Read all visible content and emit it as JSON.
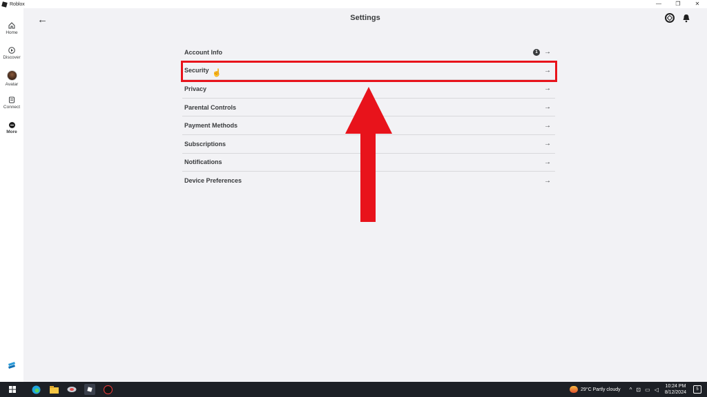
{
  "window": {
    "title": "Roblox",
    "controls": [
      "—",
      "❐",
      "✕"
    ]
  },
  "rail": {
    "items": [
      {
        "label": "Home",
        "icon": "home-icon"
      },
      {
        "label": "Discover",
        "icon": "play-icon"
      },
      {
        "label": "Avatar",
        "icon": "avatar-image"
      },
      {
        "label": "Connect",
        "icon": "chat-icon"
      },
      {
        "label": "More",
        "icon": "more-icon"
      }
    ]
  },
  "header": {
    "back_glyph": "←",
    "title": "Settings"
  },
  "settings": {
    "items": [
      {
        "label": "Account Info",
        "badge": "1",
        "arrow": "→"
      },
      {
        "label": "Security",
        "arrow": "→"
      },
      {
        "label": "Privacy",
        "arrow": "→"
      },
      {
        "label": "Parental Controls",
        "arrow": "→"
      },
      {
        "label": "Payment Methods",
        "arrow": "→"
      },
      {
        "label": "Subscriptions",
        "arrow": "→"
      },
      {
        "label": "Notifications",
        "arrow": "→"
      },
      {
        "label": "Device Preferences",
        "arrow": "→"
      }
    ]
  },
  "annotation": {
    "highlight_color": "#e8131b",
    "cursor_glyph": "☝"
  },
  "taskbar": {
    "weather": "29°C  Partly cloudy",
    "time": "10:24 PM",
    "date": "8/12/2024",
    "notifications": "5",
    "tray_glyphs": [
      "^",
      "⊡",
      "▭",
      "◁"
    ]
  }
}
